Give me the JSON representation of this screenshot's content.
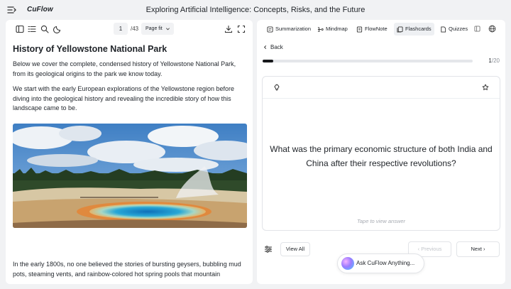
{
  "app": {
    "brand": "CuFlow",
    "document_title": "Exploring Artificial Intelligence: Concepts, Risks, and the Future"
  },
  "viewer": {
    "page_current": "1",
    "page_total": "/43",
    "fit_label": "Page fit"
  },
  "document": {
    "heading": "History of Yellowstone National Park",
    "paragraph1": "Below we cover the complete, condensed history of Yellowstone National Park, from its geological origins to the park we know today.",
    "paragraph2": "We start with the early European explorations of the Yellowstone region before diving into the geological history and revealing the incredible story of how this landscape came to be.",
    "paragraph3": "In the early 1800s, no one believed the stories of bursting geysers, bubbling mud pots, steaming vents, and rainbow-colored hot spring pools that mountain"
  },
  "tabs": [
    {
      "label": "Summarization",
      "icon": "summarization-icon"
    },
    {
      "label": "Mindmap",
      "icon": "mindmap-icon"
    },
    {
      "label": "FlowNote",
      "icon": "flownote-icon"
    },
    {
      "label": "Flashcards",
      "icon": "flashcards-icon",
      "active": true
    },
    {
      "label": "Quizzes",
      "icon": "quizzes-icon"
    }
  ],
  "flashcards": {
    "back_label": "Back",
    "progress_fraction": 0.05,
    "counter_current": "1",
    "counter_total": "/20",
    "question": "What was the primary economic structure of both India and China after their respective revolutions?",
    "hint": "Tape to view answer",
    "view_all_label": "View All",
    "previous_label": "Previous",
    "next_label": "Next"
  },
  "assistant": {
    "label": "Ask CuFlow Anything..."
  },
  "colors": {
    "background": "#f1f2f4",
    "panel": "#ffffff",
    "progress": "#16181b",
    "active_tab": "#eef0f3"
  }
}
